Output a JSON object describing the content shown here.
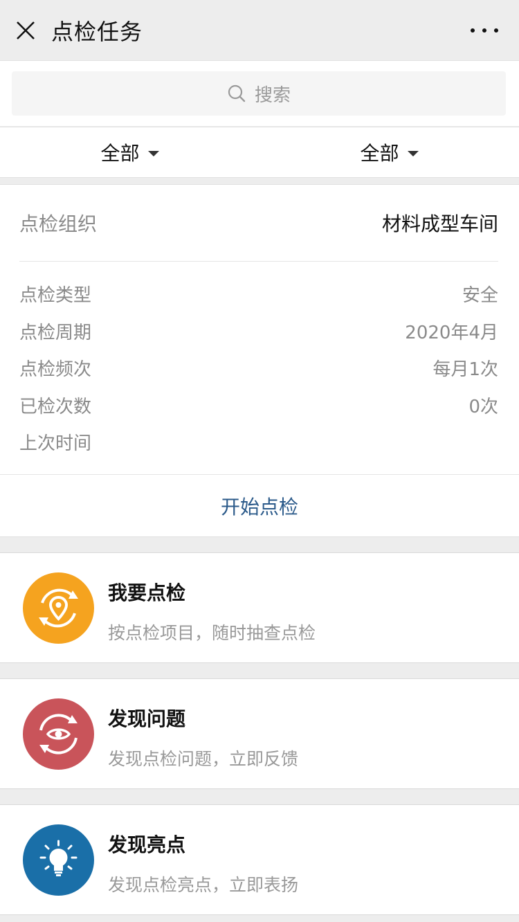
{
  "header": {
    "title": "点检任务"
  },
  "search": {
    "placeholder": "搜索"
  },
  "filters": [
    {
      "label": "全部"
    },
    {
      "label": "全部"
    }
  ],
  "info": {
    "org_label": "点检组织",
    "org_value": "材料成型车间",
    "details": [
      {
        "label": "点检类型",
        "value": "安全"
      },
      {
        "label": "点检周期",
        "value": "2020年4月"
      },
      {
        "label": "点检频次",
        "value": "每月1次"
      },
      {
        "label": "已检次数",
        "value": "0次"
      },
      {
        "label": "上次时间",
        "value": ""
      }
    ],
    "start_label": "开始点检"
  },
  "actions": [
    {
      "title": "我要点检",
      "subtitle": "按点检项目，随时抽查点检",
      "icon": "location-refresh-icon",
      "color": "#f5a31f"
    },
    {
      "title": "发现问题",
      "subtitle": "发现点检问题，立即反馈",
      "icon": "eye-refresh-icon",
      "color": "#c9545a"
    },
    {
      "title": "发现亮点",
      "subtitle": "发现点检亮点，立即表扬",
      "icon": "lightbulb-icon",
      "color": "#1a6fa8"
    }
  ]
}
